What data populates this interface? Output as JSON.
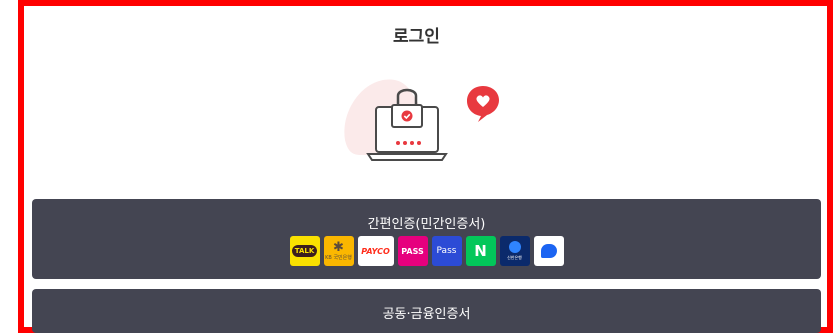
{
  "page": {
    "title": "로그인"
  },
  "simple_auth": {
    "label": "간편인증(민간인증서)",
    "providers": [
      {
        "name": "kakao-logo-icon",
        "text": "TALK"
      },
      {
        "name": "kb-logo-icon",
        "text": "KB 국민은행"
      },
      {
        "name": "payco-logo-icon",
        "text": "PAYCO"
      },
      {
        "name": "pass-logo-icon",
        "text": "PASS"
      },
      {
        "name": "samsung-pass-logo-icon",
        "text": "Pass"
      },
      {
        "name": "naver-logo-icon",
        "text": "N"
      },
      {
        "name": "shinhan-logo-icon",
        "text": "신한은행"
      },
      {
        "name": "toss-logo-icon",
        "text": ""
      }
    ]
  },
  "joint_cert": {
    "label": "공동·금융인증서"
  },
  "colors": {
    "frame": "#ff0000",
    "button_bg": "#444552",
    "accent": "#e8393f"
  }
}
